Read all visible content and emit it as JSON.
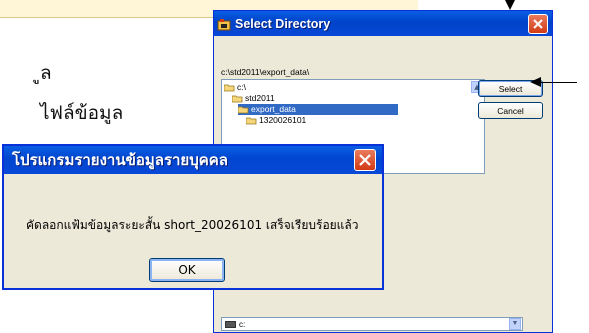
{
  "document": {
    "line1": "ูล",
    "line2": "ไฟล์ข้อมูล"
  },
  "select_directory": {
    "title": "Select Directory",
    "current_path": "c:\\std2011\\export_data\\",
    "tree": [
      {
        "label": "c:\\",
        "selected": false
      },
      {
        "label": "std2011",
        "selected": false
      },
      {
        "label": "export_data",
        "selected": true
      },
      {
        "label": "1320026101",
        "selected": false
      }
    ],
    "select_label": "Select",
    "cancel_label": "Cancel",
    "drive": "c:"
  },
  "message_box": {
    "title": "โปรแกรมรายงานข้อมูลรายบุคคล",
    "message": "คัดลอกแฟ้มข้อมูลระยะสั้น short_20026101 เสร็จเรียบร้อยแล้ว",
    "ok_label": "OK"
  },
  "colors": {
    "title_bar": "#0a5ee4",
    "close_button": "#d23a15",
    "dialog_face": "#ece9d8",
    "selection": "#316ac5"
  }
}
